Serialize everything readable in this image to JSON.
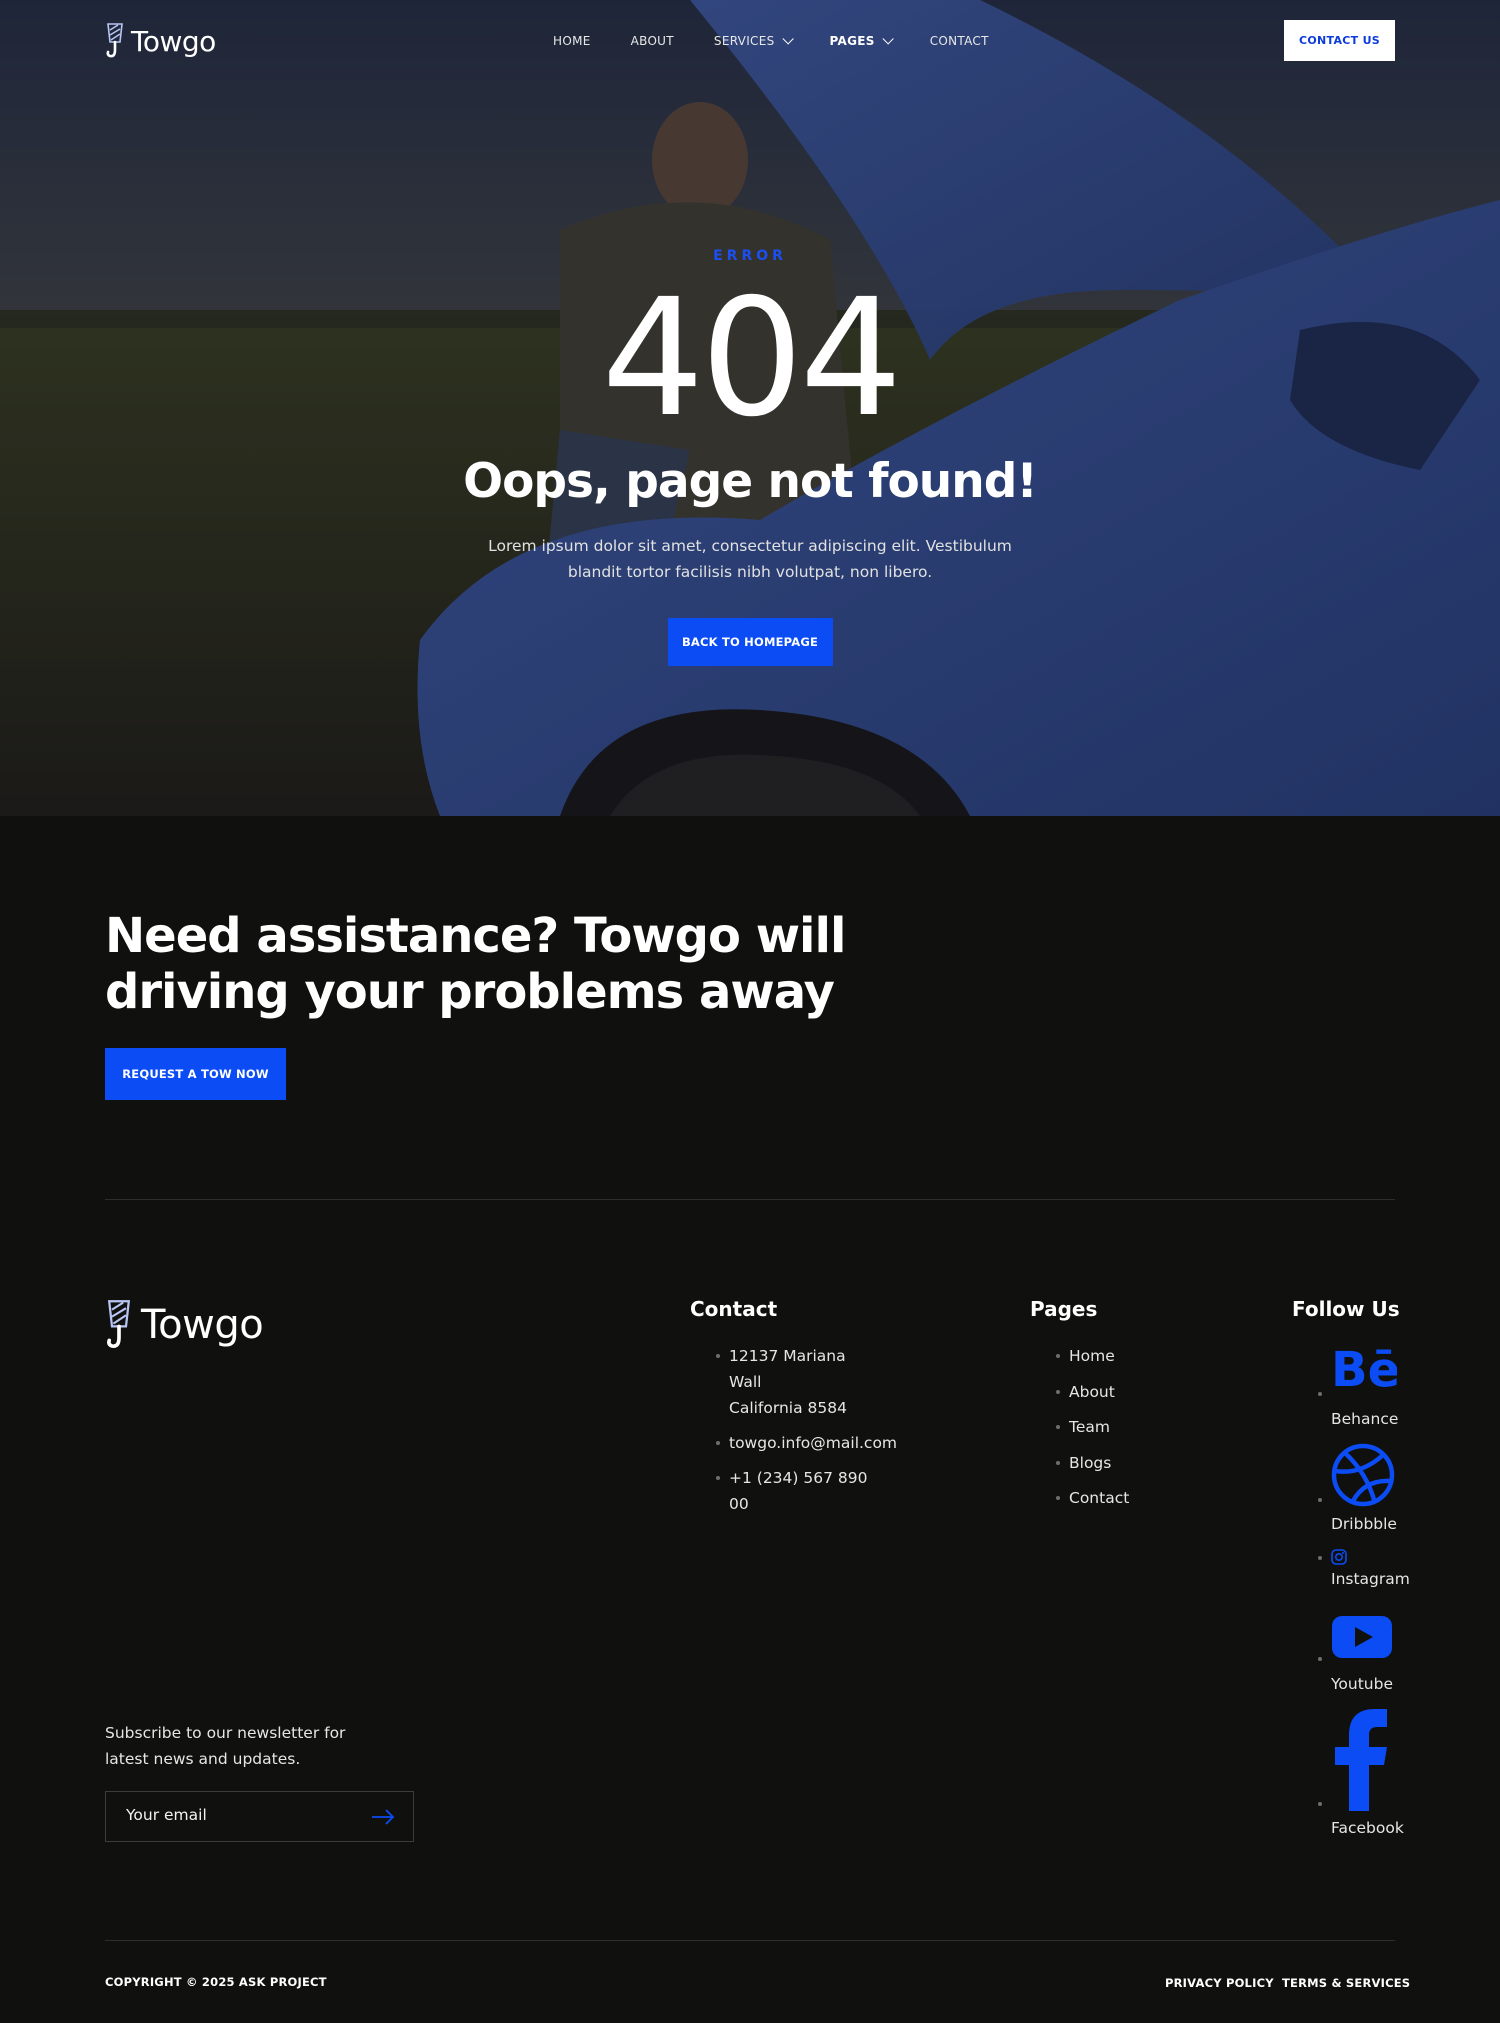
{
  "brand": {
    "name": "Towgo"
  },
  "nav": {
    "items": [
      {
        "label": "HOME",
        "dropdown": false,
        "active": false
      },
      {
        "label": "ABOUT",
        "dropdown": false,
        "active": false
      },
      {
        "label": "SERVICES",
        "dropdown": true,
        "active": false
      },
      {
        "label": "PAGES",
        "dropdown": true,
        "active": true
      },
      {
        "label": "CONTACT",
        "dropdown": false,
        "active": false
      }
    ],
    "cta_label": "CONTACT US"
  },
  "hero": {
    "eyebrow": "ERROR",
    "code": "404",
    "title": "Oops, page not found!",
    "description": "Lorem ipsum dolor sit amet, consectetur adipiscing elit. Vestibulum blandit tortor facilisis nibh volutpat, non libero.",
    "button_label": "BACK TO HOMEPAGE"
  },
  "cta": {
    "title_line1": "Need assistance? Towgo will",
    "title_line2": "driving your problems away",
    "button_label": "REQUEST A TOW NOW"
  },
  "footer": {
    "contact": {
      "title": "Contact",
      "address_line1": "12137 Mariana",
      "address_line2": "Wall",
      "address_line3": "California 8584",
      "email": "towgo.info@mail.com",
      "phone_line1": "+1 (234) 567 890",
      "phone_line2": "00"
    },
    "pages": {
      "title": "Pages",
      "items": [
        "Home",
        "About",
        "Team",
        "Blogs",
        "Contact"
      ]
    },
    "follow": {
      "title": "Follow Us",
      "items": [
        {
          "label": "Behance",
          "icon": "behance-icon"
        },
        {
          "label": "Dribbble",
          "icon": "dribbble-icon"
        },
        {
          "label": "Instagram",
          "icon": "instagram-icon"
        },
        {
          "label": "Youtube",
          "icon": "youtube-icon"
        },
        {
          "label": "Facebook",
          "icon": "facebook-icon"
        }
      ]
    },
    "newsletter": {
      "text": "Subscribe to our newsletter for latest news and updates.",
      "placeholder": "Your email"
    },
    "copyright": "COPYRIGHT © 2025 ASK PROJECT",
    "legal": [
      "PRIVACY POLICY",
      "TERMS & SERVICES"
    ]
  },
  "colors": {
    "accent": "#0b4cf5",
    "background": "#10100e",
    "text": "#ffffff"
  }
}
